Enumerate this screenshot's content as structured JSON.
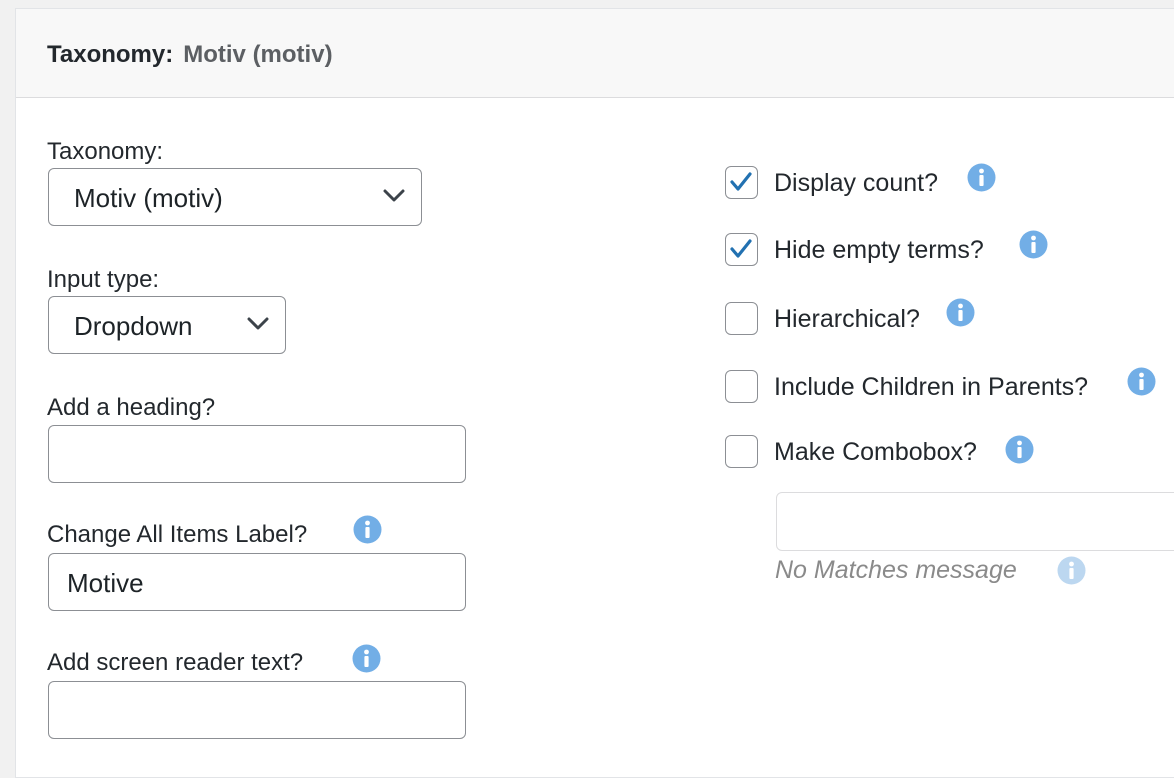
{
  "header": {
    "label": "Taxonomy:",
    "value": "Motiv (motiv)"
  },
  "left": {
    "taxonomy": {
      "label": "Taxonomy:",
      "selected": "Motiv (motiv)"
    },
    "input_type": {
      "label": "Input type:",
      "selected": "Dropdown"
    },
    "heading": {
      "label": "Add a heading?",
      "value": ""
    },
    "all_items_label": {
      "label": "Change All Items Label?",
      "value": "Motive"
    },
    "screen_reader": {
      "label": "Add screen reader text?",
      "value": ""
    }
  },
  "right": {
    "options": [
      {
        "label": "Display count?",
        "checked": true
      },
      {
        "label": "Hide empty terms?",
        "checked": true
      },
      {
        "label": "Hierarchical?",
        "checked": false
      },
      {
        "label": "Include Children in Parents?",
        "checked": false
      },
      {
        "label": "Make Combobox?",
        "checked": false
      }
    ],
    "no_matches": {
      "value": "",
      "hint": "No Matches message"
    }
  },
  "colors": {
    "accent": "#2271b1",
    "info_icon": "#72aee6",
    "info_icon_faded": "#bcd7f0",
    "border": "#8c8f94"
  },
  "icons": {
    "info": "info-icon",
    "chevron": "chevron-down-icon",
    "check": "checkmark-icon"
  }
}
